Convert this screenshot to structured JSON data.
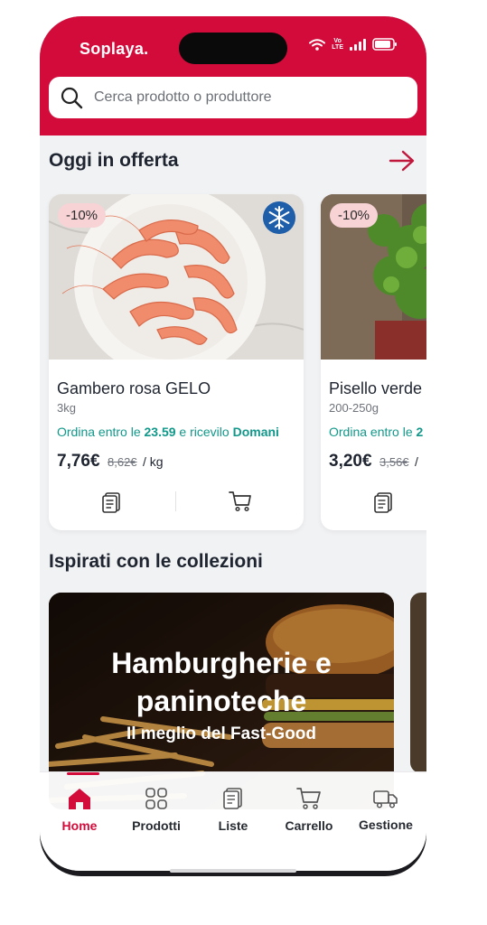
{
  "app": {
    "brand": "Soplaya."
  },
  "search": {
    "placeholder": "Cerca prodotto o produttore"
  },
  "offers": {
    "title": "Oggi in offerta",
    "products": [
      {
        "badge": "-10%",
        "name": "Gambero rosa GELO",
        "quantity": "3kg",
        "delivery_prefix": "Ordina entro le ",
        "delivery_time": "23.59",
        "delivery_mid": " e ricevilo ",
        "delivery_day": "Domani",
        "price": "7,76€",
        "old_price": "8,62€",
        "unit": "/ kg",
        "frozen_icon": "snowflake-icon"
      },
      {
        "badge": "-10%",
        "name": "Pisello verde",
        "quantity": "200-250g",
        "delivery_prefix": "Ordina entro le ",
        "delivery_time": "2",
        "price": "3,20€",
        "old_price": "3,56€",
        "unit": "/"
      }
    ]
  },
  "collections": {
    "title": "Ispirati con le collezioni",
    "items": [
      {
        "title_line1": "Hamburgherie e",
        "title_line2": "paninoteche",
        "subtitle": "Il meglio del Fast-Good"
      }
    ]
  },
  "bottom_nav": [
    {
      "label": "Home",
      "icon": "home-icon",
      "active": true
    },
    {
      "label": "Prodotti",
      "icon": "grid-icon"
    },
    {
      "label": "Liste",
      "icon": "clipboard-icon"
    },
    {
      "label": "Carrello",
      "icon": "cart-icon"
    },
    {
      "label": "Gestione",
      "icon": "truck-icon"
    }
  ],
  "colors": {
    "brand": "#d30b3a",
    "accent_green": "#11988a",
    "badge_bg": "#f7d3d6",
    "frozen_badge": "#1f5faa"
  }
}
